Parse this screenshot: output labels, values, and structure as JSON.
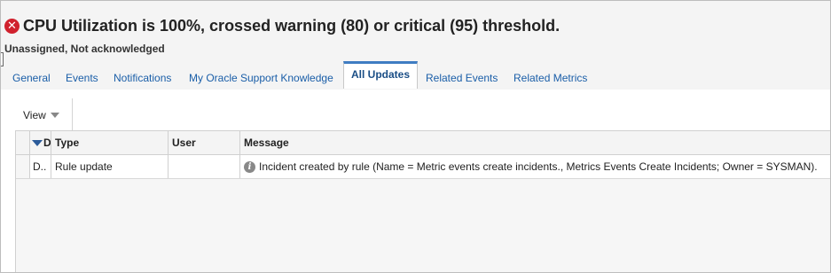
{
  "header": {
    "title": "CPU Utilization is 100%, crossed warning (80) or critical (95) threshold.",
    "status": "Unassigned, Not acknowledged",
    "status_icon": "error-icon"
  },
  "tabs": [
    {
      "label": "General",
      "active": false
    },
    {
      "label": "Events",
      "active": false
    },
    {
      "label": "Notifications",
      "active": false
    },
    {
      "label": "My Oracle Support Knowledge",
      "active": false
    },
    {
      "label": "All Updates",
      "active": true
    },
    {
      "label": "Related Events",
      "active": false
    },
    {
      "label": "Related Metrics",
      "active": false
    }
  ],
  "toolbar": {
    "view_label": "View"
  },
  "table": {
    "columns": [
      "D",
      "Type",
      "User",
      "Message"
    ],
    "rows": [
      {
        "date": "D..",
        "type": "Rule update",
        "user": "",
        "message": "Incident created by rule (Name = Metric events create incidents., Metrics Events Create Incidents; Owner = SYSMAN)."
      }
    ]
  },
  "colors": {
    "error": "#d0212d",
    "link": "#1a5ea8",
    "active_tab_border": "#3f7cc2"
  }
}
